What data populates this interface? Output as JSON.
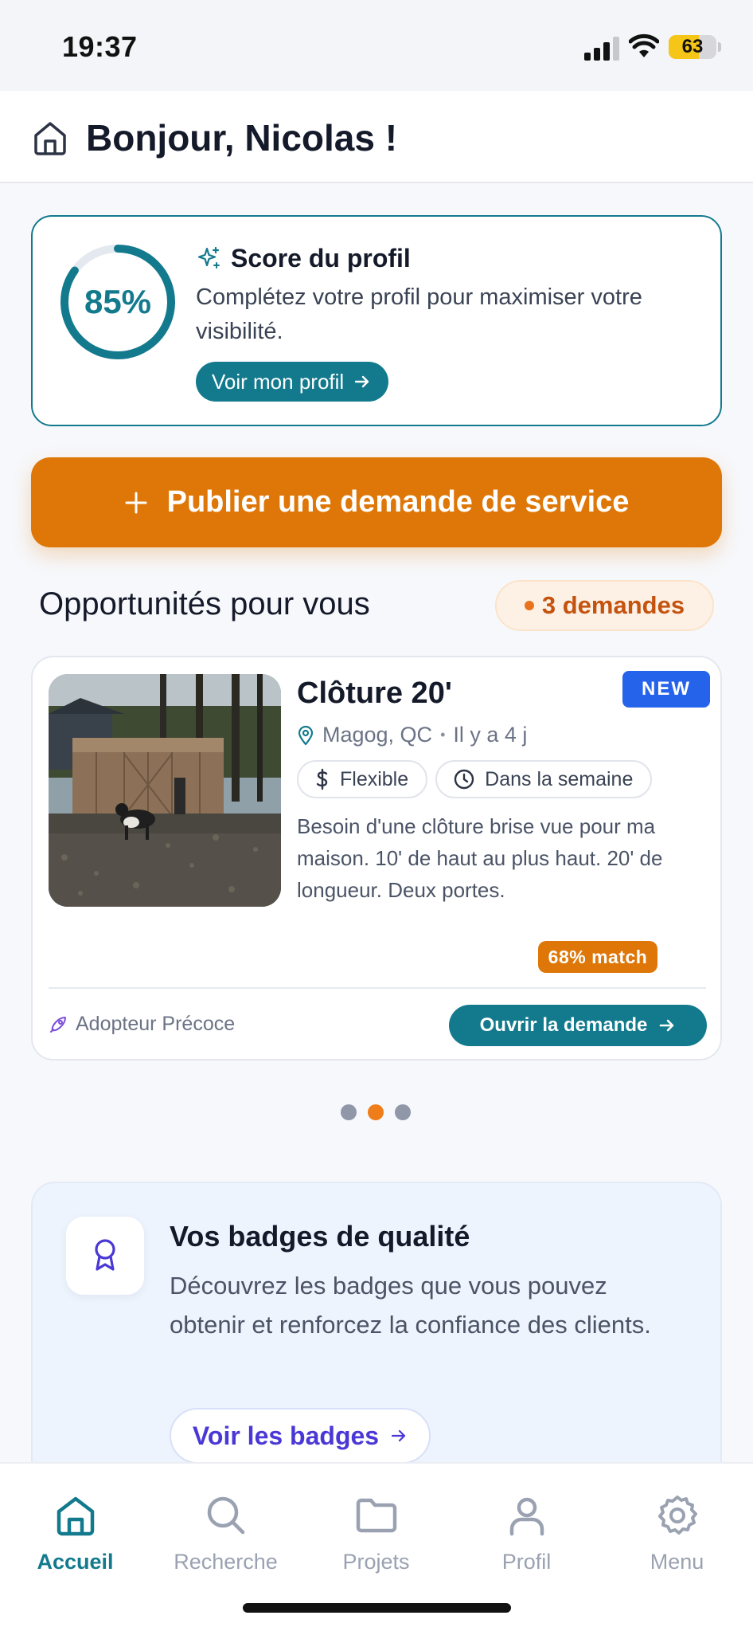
{
  "status_bar": {
    "time": "19:37",
    "battery": "63",
    "battery_level": 0.63
  },
  "header": {
    "title": "Bonjour, Nicolas !",
    "icon": "home-icon"
  },
  "score": {
    "percent_label": "85%",
    "percent_value": 0.85,
    "title": "Score du profil",
    "description": "Complétez votre profil pour maximiser votre visibilité.",
    "button_label": "Voir mon profil",
    "accent_color": "#137a8e"
  },
  "publish": {
    "label": "Publier une demande de service",
    "color": "#de7708"
  },
  "opportunities": {
    "title": "Opportunités pour vous",
    "count_label": "3 demandes"
  },
  "request": {
    "title": "Clôture 20'",
    "badge": "NEW",
    "location": "Magog, QC",
    "age": "Il y a 4 j",
    "chips": [
      {
        "icon": "dollar-icon",
        "label": "Flexible"
      },
      {
        "icon": "clock-icon",
        "label": "Dans la semaine"
      }
    ],
    "description": "Besoin d'une clôture brise vue pour ma maison. 10' de haut au plus haut. 20' de longueur. Deux portes.",
    "match": "68% match",
    "footer_tag": "Adopteur Précoce",
    "open_button": "Ouvrir la demande"
  },
  "pagination": {
    "total": 3,
    "active_index": 1
  },
  "badges": {
    "title": "Vos badges de qualité",
    "description": "Découvrez les badges que vous pouvez obtenir et renforcez la confiance des clients.",
    "button_label": "Voir les badges"
  },
  "nav": {
    "items": [
      {
        "label": "Accueil",
        "icon": "home-icon",
        "active": true
      },
      {
        "label": "Recherche",
        "icon": "search-icon",
        "active": false
      },
      {
        "label": "Projets",
        "icon": "folder-icon",
        "active": false
      },
      {
        "label": "Profil",
        "icon": "user-icon",
        "active": false
      },
      {
        "label": "Menu",
        "icon": "gear-icon",
        "active": false
      }
    ]
  }
}
